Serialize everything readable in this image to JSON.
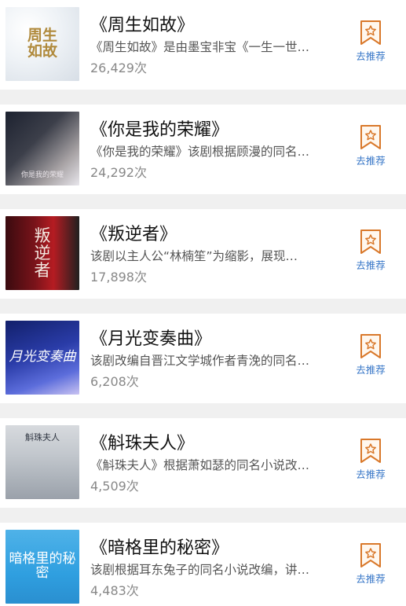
{
  "colors": {
    "page_bg": "#f0f0f0",
    "card_bg": "#ffffff",
    "title": "#111111",
    "desc": "#555555",
    "views": "#888888",
    "action": "#3a78c8",
    "bookmark_stroke": "#d9782a"
  },
  "items": [
    {
      "poster_text": "周生\n如故",
      "title": "《周生如故》",
      "desc": "《周生如故》是由墨宝非宝《一生一世…",
      "views": "26,429次",
      "action_label": "去推荐",
      "action_icon": "bookmark-star-icon"
    },
    {
      "poster_text": "你是我的荣耀",
      "title": "《你是我的荣耀》",
      "desc": "《你是我的荣耀》该剧根据顾漫的同名…",
      "views": "24,292次",
      "action_label": "去推荐",
      "action_icon": "bookmark-star-icon"
    },
    {
      "poster_text": "叛\n逆\n者",
      "title": "《叛逆者》",
      "desc": "该剧以主人公“林楠笙”为缩影，展现…",
      "views": "17,898次",
      "action_label": "去推荐",
      "action_icon": "bookmark-star-icon"
    },
    {
      "poster_text": "月光变奏曲",
      "title": "《月光变奏曲》",
      "desc": "该剧改编自晋江文学城作者青浼的同名…",
      "views": "6,208次",
      "action_label": "去推荐",
      "action_icon": "bookmark-star-icon"
    },
    {
      "poster_text": "斛珠夫人",
      "title": "《斛珠夫人》",
      "desc": "《斛珠夫人》根据萧如瑟的同名小说改…",
      "views": "4,509次",
      "action_label": "去推荐",
      "action_icon": "bookmark-star-icon"
    },
    {
      "poster_text": "暗格里的秘密",
      "title": "《暗格里的秘密》",
      "desc": "该剧根据耳东兔子的同名小说改编，讲…",
      "views": "4,483次",
      "action_label": "去推荐",
      "action_icon": "bookmark-star-icon"
    }
  ]
}
